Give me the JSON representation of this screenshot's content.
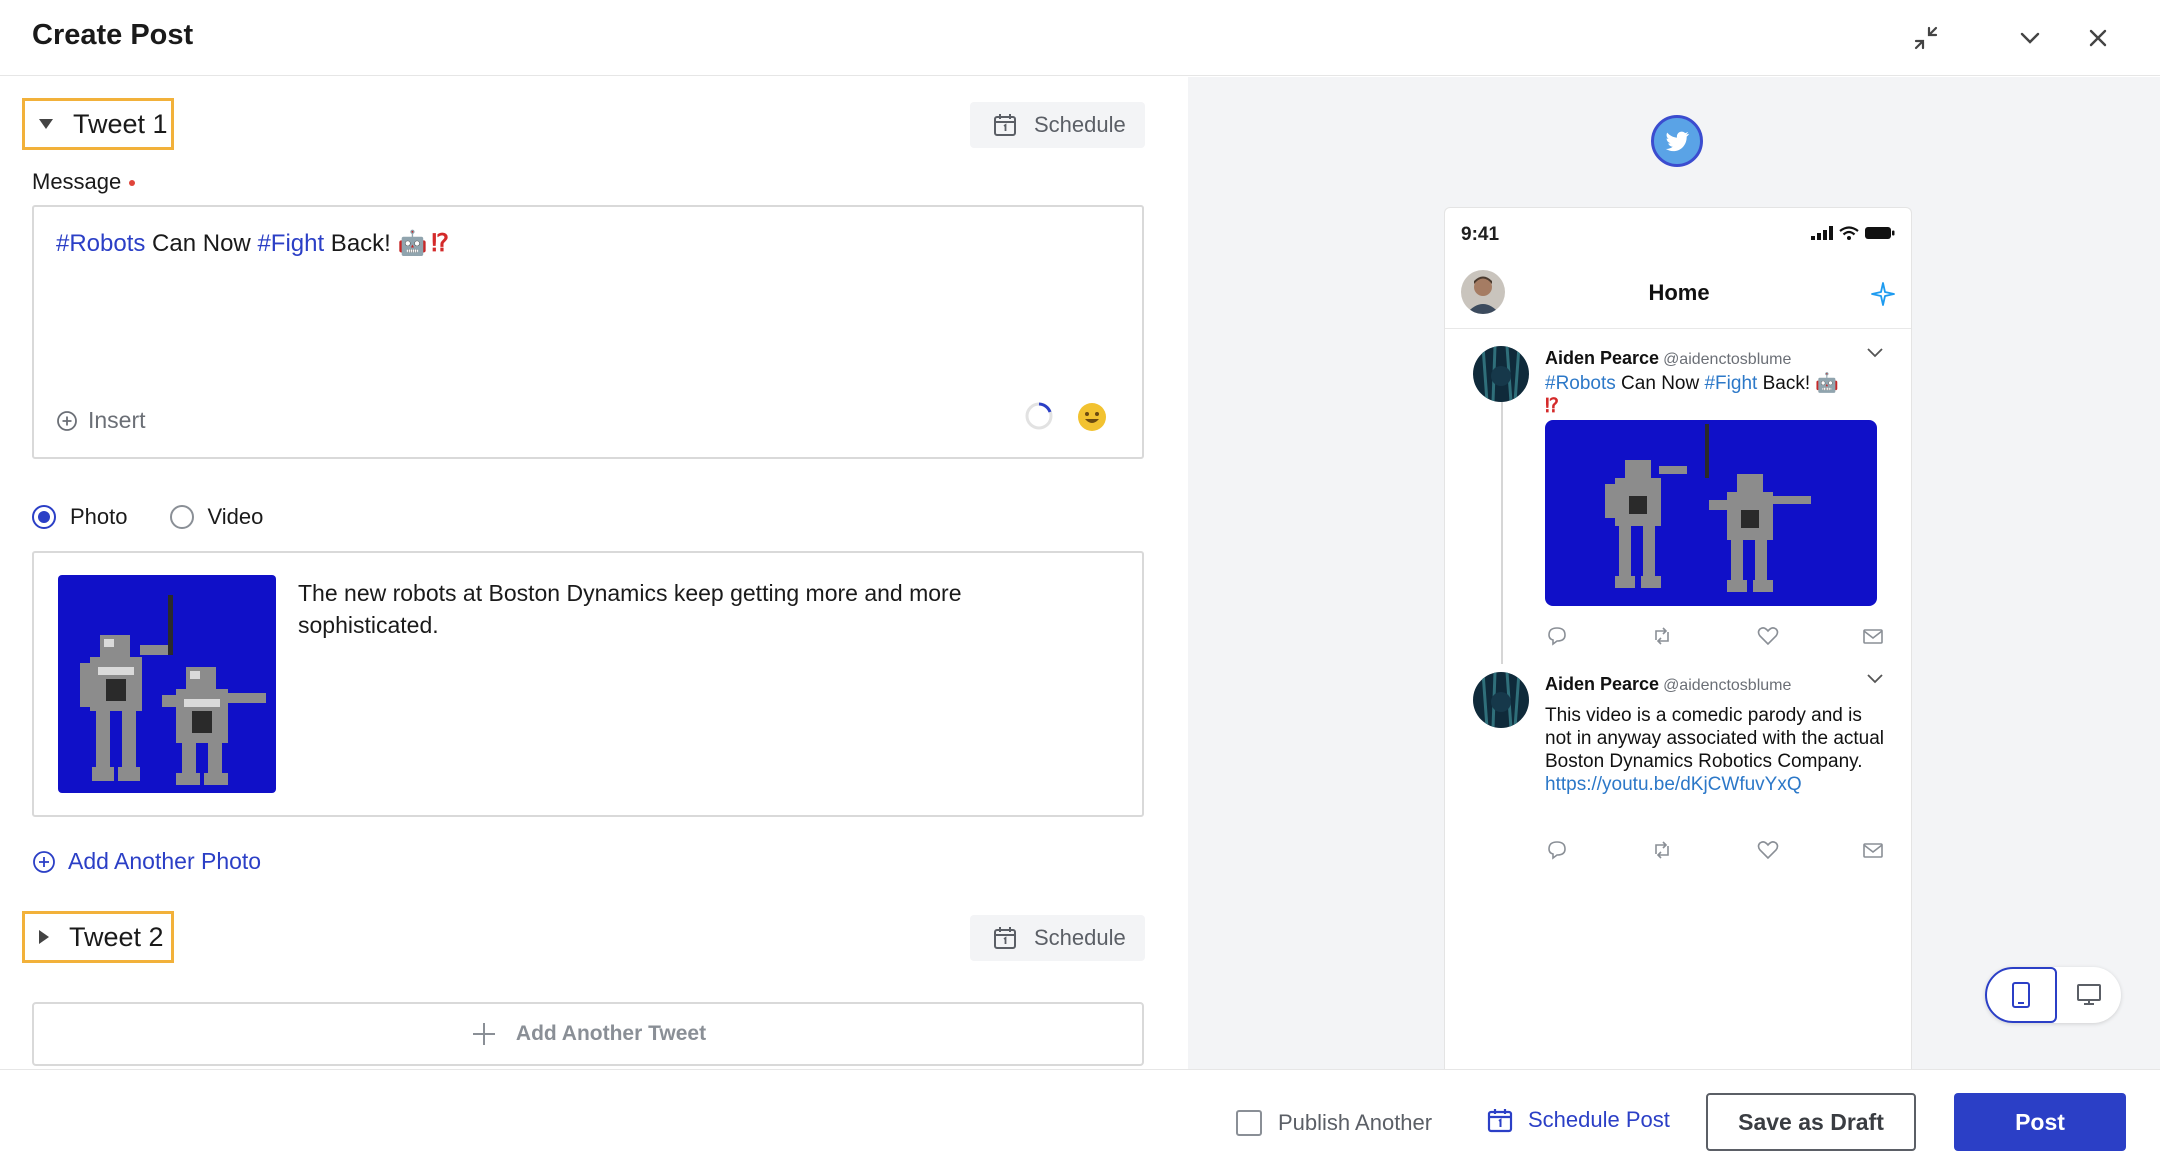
{
  "header": {
    "title": "Create Post",
    "icons": [
      "collapse-icon",
      "chevron-down-icon",
      "close-icon"
    ]
  },
  "editor": {
    "tweets": [
      {
        "label": "Tweet 1",
        "expanded": true,
        "schedule_label": "Schedule"
      },
      {
        "label": "Tweet 2",
        "expanded": false,
        "schedule_label": "Schedule"
      }
    ],
    "message_label": "Message",
    "message": {
      "hashtag1": "#Robots",
      "text1": " Can Now ",
      "hashtag2": "#Fight",
      "text2": " Back! ",
      "emoji_robot": "🤖",
      "emoji_interrobang": "⁉"
    },
    "insert_label": "Insert",
    "media_type": {
      "options": [
        "Photo",
        "Video"
      ],
      "selected": "Photo"
    },
    "photo_description": "The new robots at Boston Dynamics keep getting more and more sophisticated.",
    "add_photo_label": "Add Another Photo",
    "add_tweet_label": "Add Another Tweet"
  },
  "preview": {
    "network_icon": "twitter-bird-icon",
    "time": "9:41",
    "home_title": "Home",
    "tweets": [
      {
        "name": "Aiden Pearce",
        "handle": "@aidenctosblume",
        "hashtag1": "#Robots",
        "text1": " Can Now ",
        "hashtag2": "#Fight",
        "text2": " Back! 🤖",
        "line2": "⁉"
      },
      {
        "name": "Aiden Pearce",
        "handle": "@aidenctosblume",
        "text": "This video is a comedic parody and is not in anyway associated with the actual Boston Dynamics Robotics Company.",
        "link": "https://youtu.be/dKjCWfuvYxQ"
      }
    ],
    "view_modes": [
      "mobile",
      "desktop"
    ],
    "selected_view": "mobile"
  },
  "footer": {
    "publish_another_label": "Publish Another",
    "publish_another_checked": false,
    "schedule_post_label": "Schedule Post",
    "save_draft_label": "Save as Draft",
    "post_label": "Post"
  },
  "colors": {
    "accent": "#2b3fc6",
    "highlight_border": "#f2b13a",
    "hashtag": "#2b3fc6",
    "preview_link": "#2c78c8",
    "image_background": "#1010c8"
  }
}
